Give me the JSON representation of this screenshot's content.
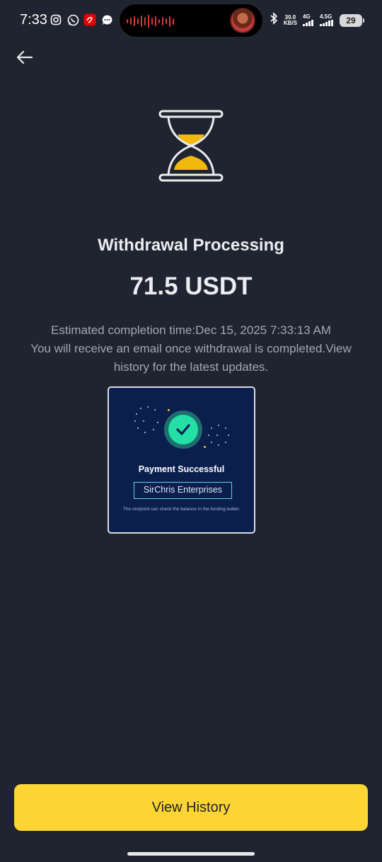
{
  "status_bar": {
    "time": "7:33",
    "net_speed_value": "30.0",
    "net_speed_unit": "KB/S",
    "signal_1": "4G",
    "signal_2": "4.5G",
    "battery": "29",
    "icons": [
      "instagram-icon",
      "whatsapp-icon",
      "airtel-icon",
      "messages-icon",
      "bluetooth-icon",
      "signal-icon"
    ]
  },
  "header": {
    "back_icon": "arrow-left-icon"
  },
  "status": {
    "icon": "hourglass-icon",
    "title": "Withdrawal Processing",
    "amount": "71.5 USDT",
    "estimated_line": "Estimated completion time:Dec 15, 2025 7:33:13 AM",
    "email_note": "You will receive an email once withdrawal is completed.View history for the latest updates."
  },
  "receipt_image": {
    "title": "Payment Successful",
    "merchant": "SirChris Enterprises",
    "note": "The recipient can check the balance in the funding wallet."
  },
  "actions": {
    "view_history_label": "View History"
  },
  "colors": {
    "background": "#1f2430",
    "accent_yellow": "#fcd535",
    "text_primary": "#eaecef",
    "text_secondary": "#a2a8b3",
    "success_green": "#22e0a6"
  }
}
